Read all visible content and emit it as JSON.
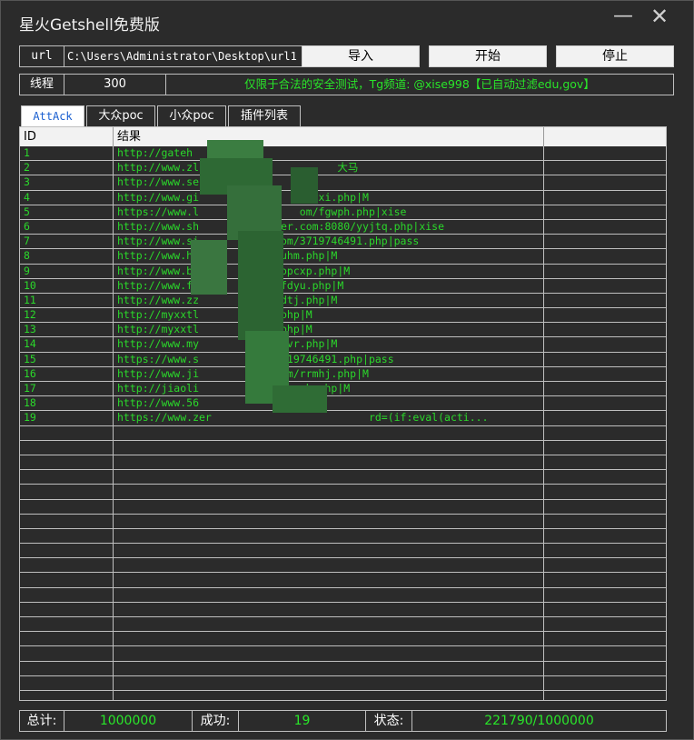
{
  "window": {
    "title": "星火Getshell免费版",
    "minimize_glyph": "—",
    "close_glyph": "✕"
  },
  "top": {
    "url_label": "url",
    "url_value": "C:\\Users\\Administrator\\Desktop\\url1",
    "import_label": "导入",
    "start_label": "开始",
    "stop_label": "停止",
    "threads_label": "线程",
    "threads_value": "300",
    "notice": "仅限于合法的安全测试，Tg频道: @xise998【已自动过滤edu,gov】"
  },
  "tabs": [
    {
      "label": "AttAck",
      "active": true
    },
    {
      "label": "大众poc",
      "active": false
    },
    {
      "label": "小众poc",
      "active": false
    },
    {
      "label": "插件列表",
      "active": false
    }
  ],
  "table": {
    "columns": [
      "ID",
      "结果",
      ""
    ],
    "rows": [
      {
        "id": "1",
        "result": "http://gateh"
      },
      {
        "id": "2",
        "result": "http://www.zl                      大马"
      },
      {
        "id": "3",
        "result": "http://www.se"
      },
      {
        "id": "4",
        "result": "http://www.gi                   xi.php|M"
      },
      {
        "id": "5",
        "result": "https://www.l                om/fgwph.php|xise"
      },
      {
        "id": "6",
        "result": "http://www.sh             er.com:8080/yyjtq.php|xise"
      },
      {
        "id": "7",
        "result": "http://www.si             om/3719746491.php|pass"
      },
      {
        "id": "8",
        "result": "http://www.hr             uhm.php|M"
      },
      {
        "id": "9",
        "result": "http://www.bc            /opcxp.php|M"
      },
      {
        "id": "10",
        "result": "http://www.fs             fdyu.php|M"
      },
      {
        "id": "11",
        "result": "http://www.zz             dtj.php|M"
      },
      {
        "id": "12",
        "result": "http://myxxtl             php|M"
      },
      {
        "id": "13",
        "result": "http://myxxtl             php|M"
      },
      {
        "id": "14",
        "result": "http://www.my             zvr.php|M"
      },
      {
        "id": "15",
        "result": "https://www.s            3719746491.php|pass"
      },
      {
        "id": "16",
        "result": "http://www.ji            com/rrmhj.php|M"
      },
      {
        "id": "17",
        "result": "http://jiaoli            /vsexh.php|M"
      },
      {
        "id": "18",
        "result": "http://www.56"
      },
      {
        "id": "19",
        "result": "https://www.zer                         rd=(if:eval(acti..."
      }
    ],
    "empty_rows": 19
  },
  "status": {
    "total_label": "总计:",
    "total_value": "1000000",
    "success_label": "成功:",
    "success_value": "19",
    "state_label": "状态:",
    "state_value": "221790/1000000"
  },
  "colors": {
    "accent_green": "#29e629",
    "background": "#2b2b2b",
    "tab_active_text": "#1a5fd0"
  }
}
